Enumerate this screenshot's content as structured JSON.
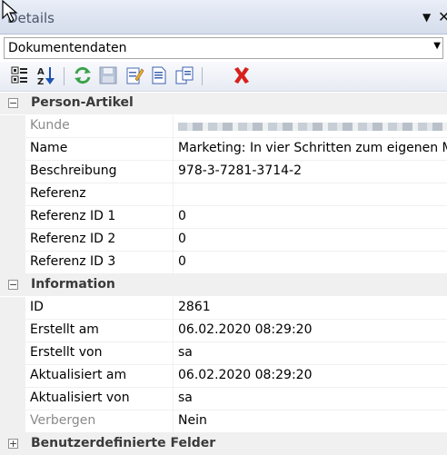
{
  "panel": {
    "title": "Details",
    "pin_glyph": "▼",
    "close_glyph": "✕"
  },
  "selector": {
    "value": "Dokumentendaten"
  },
  "toolbar": {
    "icons": [
      "categorized-view-icon",
      "alphabetical-sort-icon",
      "refresh-icon",
      "save-icon",
      "edit-icon",
      "new-document-icon",
      "copy-icon",
      "delete-icon"
    ]
  },
  "categories": [
    {
      "label": "Person-Artikel",
      "expanded": true,
      "toggle": "−",
      "rows": [
        {
          "name": "Kunde",
          "value": "",
          "disabled": true
        },
        {
          "name": "Name",
          "value": "Marketing: In vier Schritten zum eigenen M"
        },
        {
          "name": "Beschreibung",
          "value": "978-3-7281-3714-2"
        },
        {
          "name": "Referenz",
          "value": ""
        },
        {
          "name": "Referenz ID 1",
          "value": "0"
        },
        {
          "name": "Referenz ID 2",
          "value": "0"
        },
        {
          "name": "Referenz ID 3",
          "value": "0"
        }
      ]
    },
    {
      "label": "Information",
      "expanded": true,
      "toggle": "−",
      "rows": [
        {
          "name": "ID",
          "value": "2861"
        },
        {
          "name": "Erstellt am",
          "value": "06.02.2020 08:29:20"
        },
        {
          "name": "Erstellt von",
          "value": "sa"
        },
        {
          "name": "Aktualisiert am",
          "value": "06.02.2020 08:29:20"
        },
        {
          "name": "Aktualisiert von",
          "value": "sa"
        },
        {
          "name": "Verbergen",
          "value": "Nein",
          "disabled": true
        }
      ]
    },
    {
      "label": "Benutzerdefinierte Felder",
      "expanded": false,
      "toggle": "+"
    }
  ]
}
